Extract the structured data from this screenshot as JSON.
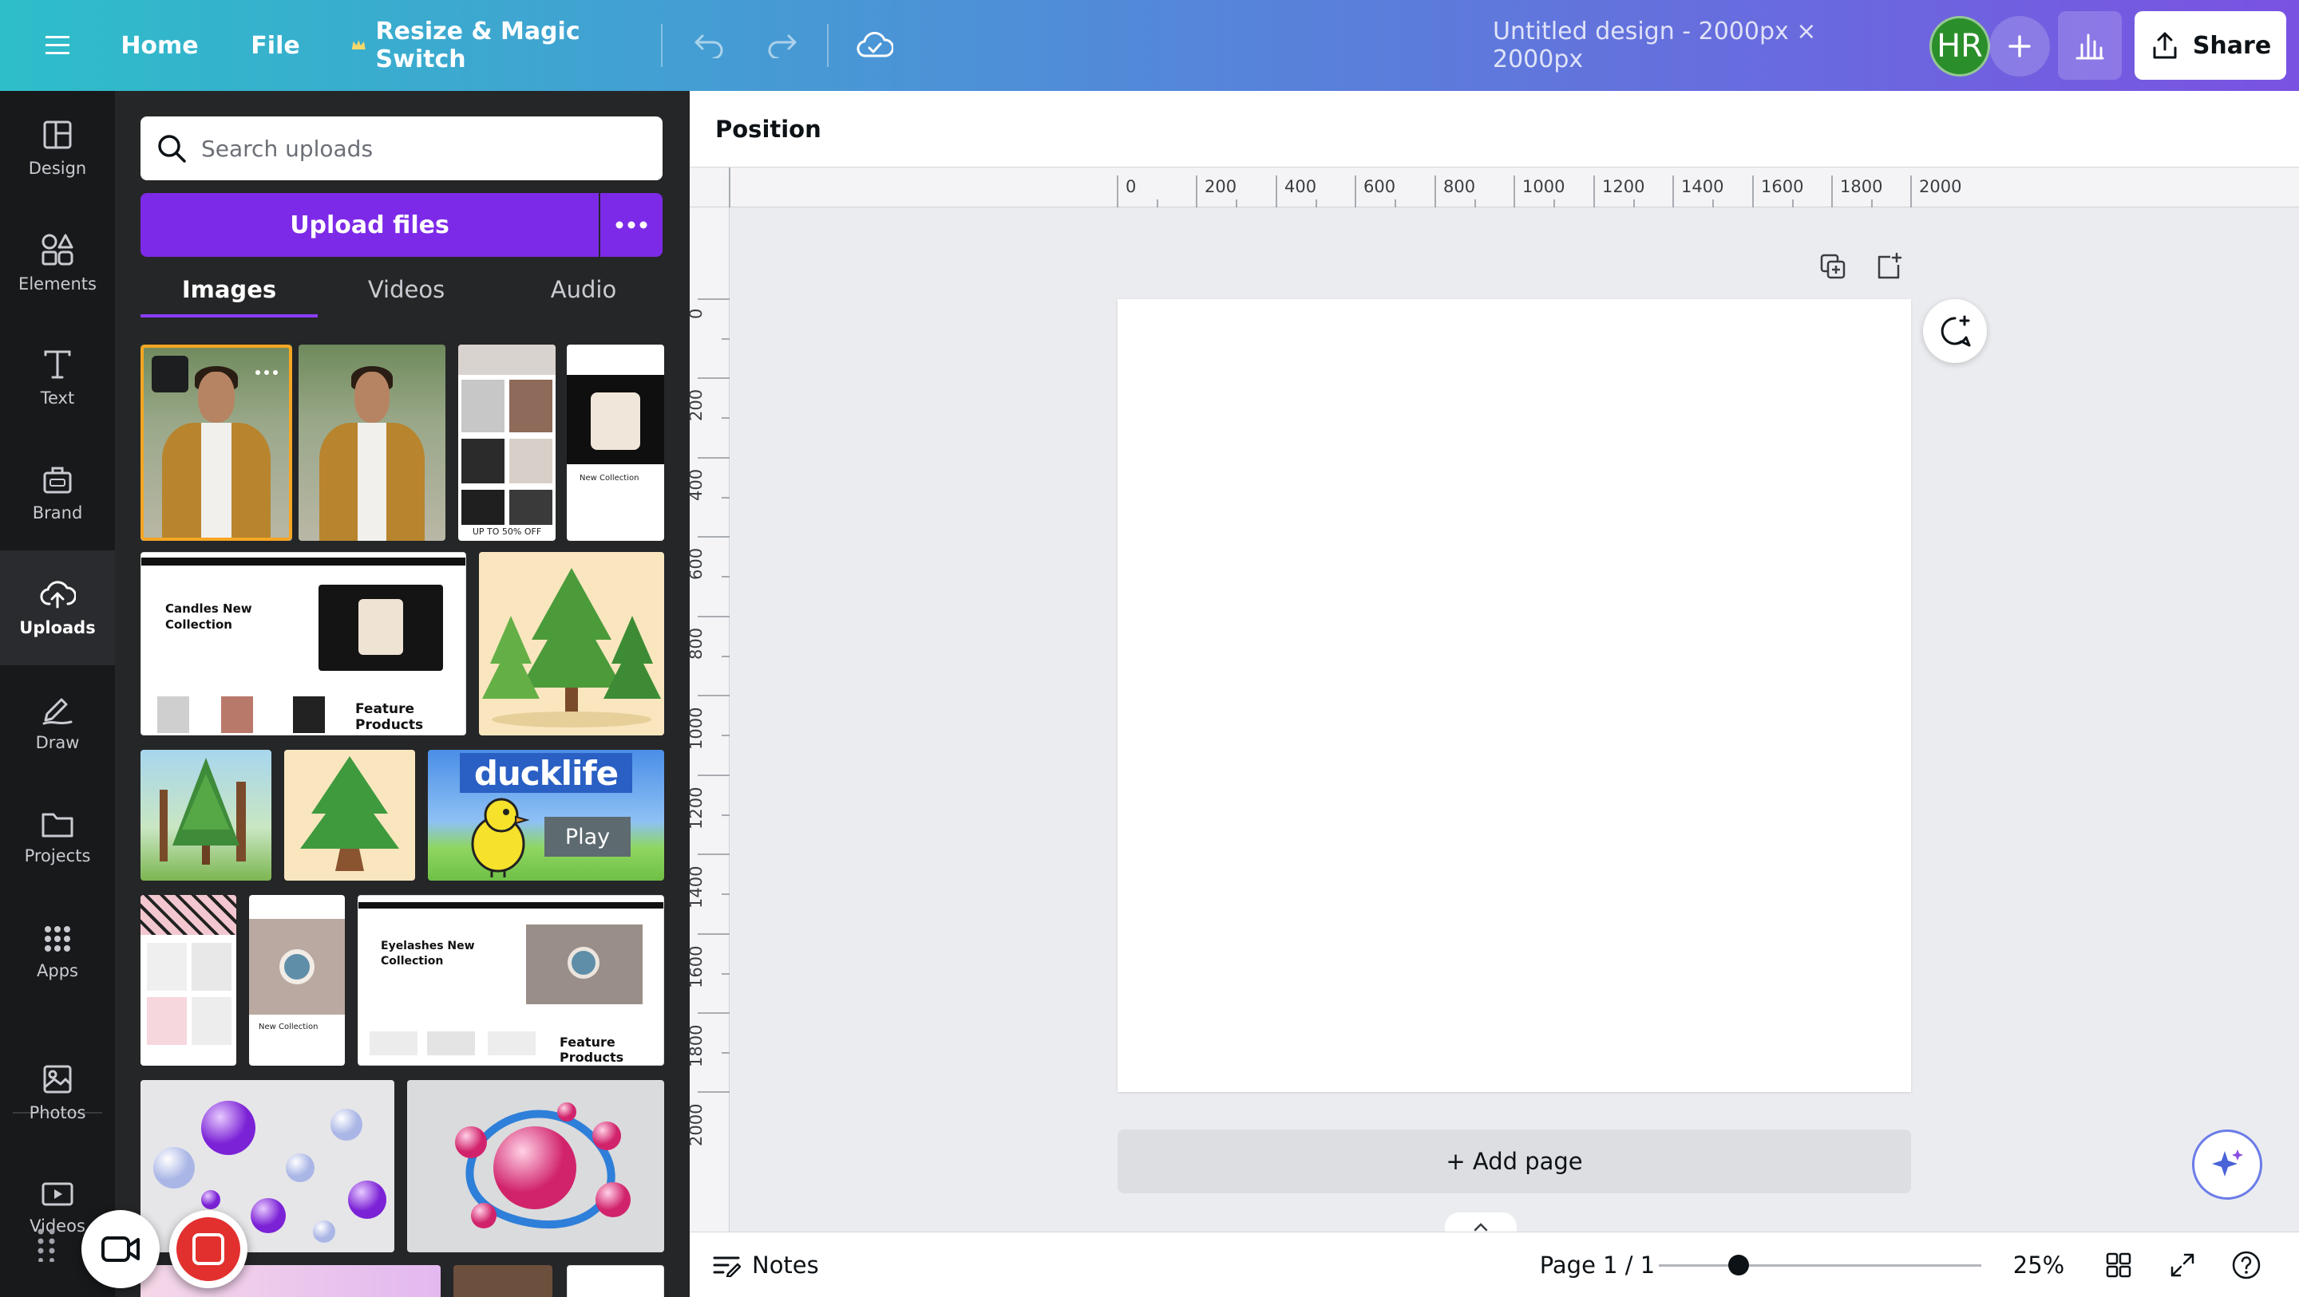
{
  "topbar": {
    "home_label": "Home",
    "file_label": "File",
    "resize_label": "Resize & Magic Switch",
    "doc_title": "Untitled design - 2000px × 2000px",
    "avatar_initials": "HR",
    "share_label": "Share"
  },
  "rail": {
    "items": [
      {
        "label": "Design",
        "icon": "design-icon"
      },
      {
        "label": "Elements",
        "icon": "elements-icon"
      },
      {
        "label": "Text",
        "icon": "text-icon"
      },
      {
        "label": "Brand",
        "icon": "brand-icon"
      },
      {
        "label": "Uploads",
        "icon": "cloud-upload-icon",
        "active": true
      },
      {
        "label": "Draw",
        "icon": "draw-icon"
      },
      {
        "label": "Projects",
        "icon": "folder-icon"
      },
      {
        "label": "Apps",
        "icon": "apps-icon"
      },
      {
        "label": "Photos",
        "icon": "photo-icon"
      },
      {
        "label": "Videos",
        "icon": "video-icon"
      }
    ]
  },
  "panel": {
    "search_placeholder": "Search uploads",
    "upload_label": "Upload files",
    "tabs": [
      {
        "label": "Images",
        "active": true
      },
      {
        "label": "Videos",
        "active": false
      },
      {
        "label": "Audio",
        "active": false
      }
    ],
    "thumbnails": {
      "candles_heading": "Candles New Collection",
      "candles_feature": "Feature Products",
      "candles_sale": "UP TO 50% OFF",
      "candles_new": "New Collection",
      "duck_title": "ducklife",
      "duck_play": "Play",
      "lash_heading": "Eyelashes New Collection",
      "lash_feature": "Feature Products",
      "lash_new": "New Collection"
    }
  },
  "editor": {
    "position_label": "Position",
    "ruler_h": [
      "0",
      "200",
      "400",
      "600",
      "800",
      "1000",
      "1200",
      "1400",
      "1600",
      "1800",
      "2000"
    ],
    "ruler_v": [
      "0",
      "200",
      "400",
      "600",
      "800",
      "1000",
      "1200",
      "1400",
      "1600",
      "1800",
      "2000"
    ],
    "add_page_label": "+ Add page"
  },
  "bottombar": {
    "notes_label": "Notes",
    "page_indicator": "Page 1 / 1",
    "zoom_value": 25,
    "zoom_label": "25%"
  },
  "colors": {
    "accent": "#7d2ae8",
    "selection": "#f5a623",
    "avatar_bg": "#2a8f2a",
    "record": "#e2302e"
  }
}
